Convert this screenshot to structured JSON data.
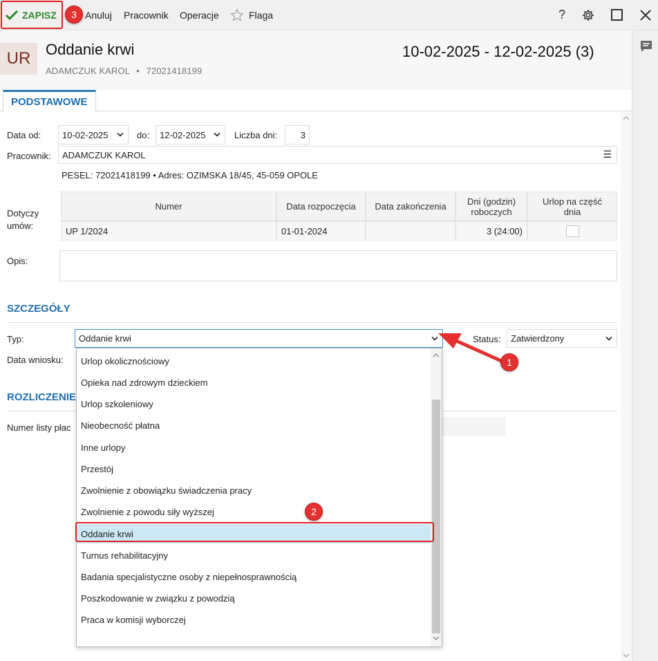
{
  "toolbar": {
    "save_label": "ZAPISZ",
    "cancel_label": "Anuluj",
    "employee_label": "Pracownik",
    "operations_label": "Operacje",
    "flag_label": "Flaga",
    "help_label": "?"
  },
  "markers": {
    "m1": "1",
    "m2": "2",
    "m3": "3"
  },
  "header": {
    "badge": "UR",
    "title": "Oddanie krwi",
    "employee_name": "ADAMCZUK KAROL",
    "separator": "•",
    "employee_id": "72021418199",
    "date_range": "10-02-2025 - 12-02-2025 (3)"
  },
  "tabs": {
    "active": "PODSTAWOWE"
  },
  "basic": {
    "date_from_label": "Data od:",
    "date_from": "10-02-2025",
    "date_to_label": "do:",
    "date_to": "12-02-2025",
    "days_label": "Liczba dni:",
    "days": "3",
    "employee_label": "Pracownik:",
    "employee": "ADAMCZUK KAROL",
    "pesel_line": "PESEL:  72021418199  •  Adres:  OZIMSKA 18/45, 45-059 OPOLE",
    "contracts_label": "Dotyczy umów:",
    "description_label": "Opis:"
  },
  "contracts_table": {
    "headers": [
      "Numer",
      "Data rozpoczęcia",
      "Data zakończenia",
      "Dni (godzin) roboczych",
      "Urlop na część dnia"
    ],
    "rows": [
      {
        "number": "UP 1/2024",
        "start": "01-01-2024",
        "end": "",
        "days": "3  (24:00)",
        "partial": false
      }
    ]
  },
  "details": {
    "section_title": "SZCZEGÓŁY",
    "type_label": "Typ:",
    "type_value": "Oddanie krwi",
    "status_label": "Status:",
    "status_value": "Zatwierdzony",
    "request_date_label": "Data wniosku:"
  },
  "settlement": {
    "section_title": "ROZLICZENIE",
    "payroll_label": "Numer listy płac"
  },
  "type_options": [
    "Urlop okolicznościowy",
    "Opieka nad zdrowym dzieckiem",
    "Urlop szkoleniowy",
    "Nieobecność płatna",
    "Inne urlopy",
    "Przestój",
    "Zwolnienie z obowiązku świadczenia pracy",
    "Zwolnienie z powodu siły wyższej",
    "Oddanie krwi",
    "Turnus rehabilitacyjny",
    "Badania specjalistyczne osoby z niepełnosprawnością",
    "Poszkodowanie w związku z powodzią",
    "Praca w komisji wyborczej"
  ],
  "selected_option_index": 8,
  "colors": {
    "accent": "#1f6fb0",
    "save_green": "#2e8b2e",
    "annotation_red": "#e53030",
    "selected_bg": "#cce8f4"
  },
  "icons": [
    "checkmark-icon",
    "star-icon",
    "help-icon",
    "gear-icon",
    "maximize-icon",
    "close-icon",
    "comment-icon",
    "menu-icon",
    "chevron-down-icon"
  ]
}
